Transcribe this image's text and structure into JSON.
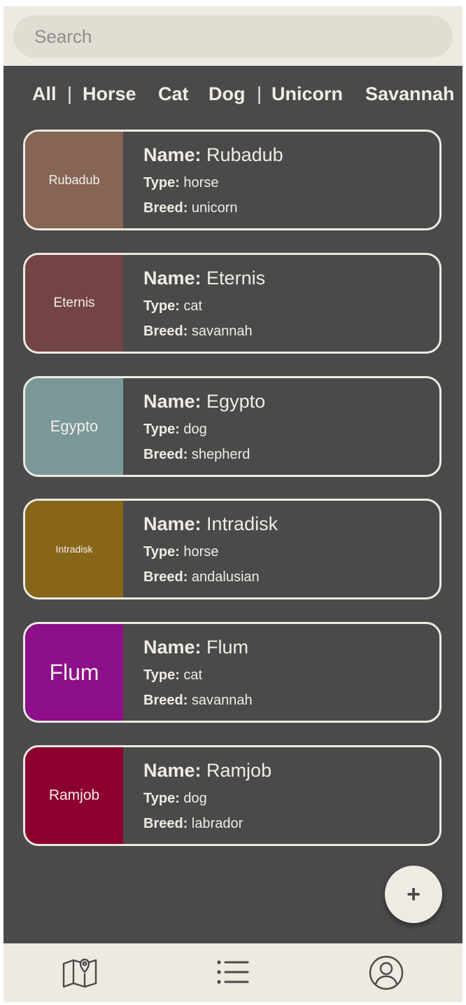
{
  "search": {
    "placeholder": "Search"
  },
  "filters": [
    "All",
    "|",
    "Horse",
    "Cat",
    "Dog",
    "|",
    "Unicorn",
    "Savannah"
  ],
  "labels": {
    "name": "Name:",
    "type": "Type:",
    "breed": "Breed:"
  },
  "pets": [
    {
      "thumb": "Rubadub",
      "name": "Rubadub",
      "type": "horse",
      "breed": "unicorn",
      "color": "#866555"
    },
    {
      "thumb": "Eternis",
      "name": "Eternis",
      "type": "cat",
      "breed": "savannah",
      "color": "#734444"
    },
    {
      "thumb": "Egypto",
      "name": "Egypto",
      "type": "dog",
      "breed": "shepherd",
      "color": "#7a9898"
    },
    {
      "thumb": "Intradisk",
      "name": "Intradisk",
      "type": "horse",
      "breed": "andalusian",
      "color": "#87661a"
    },
    {
      "thumb": "Flum",
      "name": "Flum",
      "type": "cat",
      "breed": "savannah",
      "color": "#8e0f8a"
    },
    {
      "thumb": "Ramjob",
      "name": "Ramjob",
      "type": "dog",
      "breed": "labrador",
      "color": "#8c0030"
    }
  ],
  "fab": {
    "label": "+"
  },
  "nav": {
    "icons": [
      "map-icon",
      "list-icon",
      "profile-icon"
    ]
  }
}
